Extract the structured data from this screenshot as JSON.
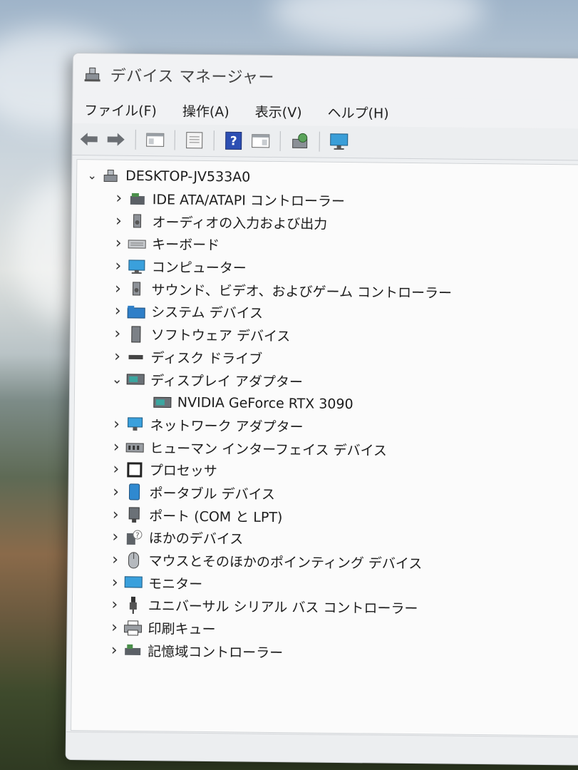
{
  "window": {
    "title": "デバイス マネージャー"
  },
  "menu": [
    "ファイル(F)",
    "操作(A)",
    "表示(V)",
    "ヘルプ(H)"
  ],
  "toolbar": {
    "buttons": [
      {
        "name": "back-button",
        "icon": "arrow-left-icon"
      },
      {
        "name": "forward-button",
        "icon": "arrow-right-icon"
      },
      {
        "name": "show-hide-console-tree-button",
        "icon": "console-tree-icon"
      },
      {
        "name": "properties-button",
        "icon": "properties-icon"
      },
      {
        "name": "help-button",
        "icon": "help-icon"
      },
      {
        "name": "action-pane-button",
        "icon": "action-pane-icon"
      },
      {
        "name": "scan-hardware-button",
        "icon": "scan-hardware-icon"
      },
      {
        "name": "monitor-button",
        "icon": "monitor-icon"
      }
    ]
  },
  "tree": {
    "root": "DESKTOP-JV533A0",
    "items": [
      {
        "label": "IDE ATA/ATAPI コントローラー",
        "icon": "ide-controller-icon",
        "expanded": false
      },
      {
        "label": "オーディオの入力および出力",
        "icon": "speaker-icon",
        "expanded": false
      },
      {
        "label": "キーボード",
        "icon": "keyboard-icon",
        "expanded": false
      },
      {
        "label": "コンピューター",
        "icon": "computer-icon",
        "expanded": false
      },
      {
        "label": "サウンド、ビデオ、およびゲーム コントローラー",
        "icon": "speaker-icon",
        "expanded": false
      },
      {
        "label": "システム デバイス",
        "icon": "folder-icon",
        "expanded": false
      },
      {
        "label": "ソフトウェア デバイス",
        "icon": "software-device-icon",
        "expanded": false
      },
      {
        "label": "ディスク ドライブ",
        "icon": "disk-drive-icon",
        "expanded": false
      },
      {
        "label": "ディスプレイ アダプター",
        "icon": "display-adapter-icon",
        "expanded": true,
        "children": [
          {
            "label": "NVIDIA GeForce RTX 3090",
            "icon": "display-adapter-icon"
          }
        ]
      },
      {
        "label": "ネットワーク アダプター",
        "icon": "network-adapter-icon",
        "expanded": false
      },
      {
        "label": "ヒューマン インターフェイス デバイス",
        "icon": "hid-icon",
        "expanded": false
      },
      {
        "label": "プロセッサ",
        "icon": "processor-icon",
        "expanded": false
      },
      {
        "label": "ポータブル デバイス",
        "icon": "portable-device-icon",
        "expanded": false
      },
      {
        "label": "ポート (COM と LPT)",
        "icon": "port-icon",
        "expanded": false
      },
      {
        "label": "ほかのデバイス",
        "icon": "other-device-icon",
        "expanded": false
      },
      {
        "label": "マウスとそのほかのポインティング デバイス",
        "icon": "mouse-icon",
        "expanded": false
      },
      {
        "label": "モニター",
        "icon": "monitor-icon",
        "expanded": false
      },
      {
        "label": "ユニバーサル シリアル バス コントローラー",
        "icon": "usb-icon",
        "expanded": false
      },
      {
        "label": "印刷キュー",
        "icon": "printer-icon",
        "expanded": false
      },
      {
        "label": "記憶域コントローラー",
        "icon": "storage-controller-icon",
        "expanded": false
      }
    ]
  },
  "colors": {
    "window_bg": "#eef0f2",
    "tree_bg": "#fbfbfb",
    "accent_blue": "#2b7bd6"
  }
}
